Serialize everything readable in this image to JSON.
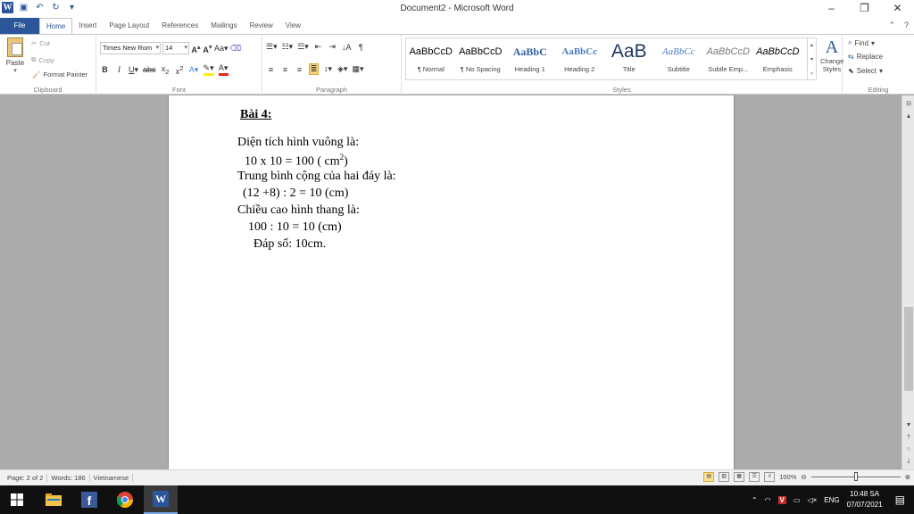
{
  "window": {
    "title": "Document2 - Microsoft Word"
  },
  "tabs": [
    "File",
    "Home",
    "Insert",
    "Page Layout",
    "References",
    "Mailings",
    "Review",
    "View"
  ],
  "ribbon": {
    "clipboard": {
      "label": "Clipboard",
      "paste": "Paste",
      "cut": "Cut",
      "copy": "Copy",
      "format_painter": "Format Painter"
    },
    "font": {
      "label": "Font",
      "font_name": "Times New Rom",
      "font_size": "14"
    },
    "paragraph": {
      "label": "Paragraph"
    },
    "styles": {
      "label": "Styles",
      "items": [
        {
          "sample": "AaBbCcD",
          "name": "¶ Normal"
        },
        {
          "sample": "AaBbCcD",
          "name": "¶ No Spacing"
        },
        {
          "sample": "AaBbC",
          "name": "Heading 1"
        },
        {
          "sample": "AaBbCc",
          "name": "Heading 2"
        },
        {
          "sample": "AaB",
          "name": "Title"
        },
        {
          "sample": "AaBbCc",
          "name": "Subtitle"
        },
        {
          "sample": "AaBbCcD",
          "name": "Subtle Emp..."
        },
        {
          "sample": "AaBbCcD",
          "name": "Emphasis"
        }
      ],
      "change_styles": "Change Styles"
    },
    "editing": {
      "label": "Editing",
      "find": "Find",
      "replace": "Replace",
      "select": "Select"
    }
  },
  "document": {
    "heading": "Bài 4:",
    "lines": [
      "Diện tích hình vuông là:",
      "10 x 10 = 100 ( cm",
      "Trung bình cộng của hai đáy là:",
      "(12 +8) : 2 = 10 (cm)",
      "Chiều cao hình thang là:",
      "100 : 10 = 10 (cm)",
      "Đáp số: 10cm."
    ],
    "superscript": "2",
    "closing_paren": ")"
  },
  "status": {
    "page": "Page: 2 of 2",
    "words": "Words: 186",
    "language": "Vietnamese",
    "zoom": "100%"
  },
  "taskbar": {
    "language": "ENG",
    "time": "10:48 SA",
    "date": "07/07/2021"
  },
  "colors": {
    "accent": "#2b579a",
    "taskbar": "#101010"
  }
}
